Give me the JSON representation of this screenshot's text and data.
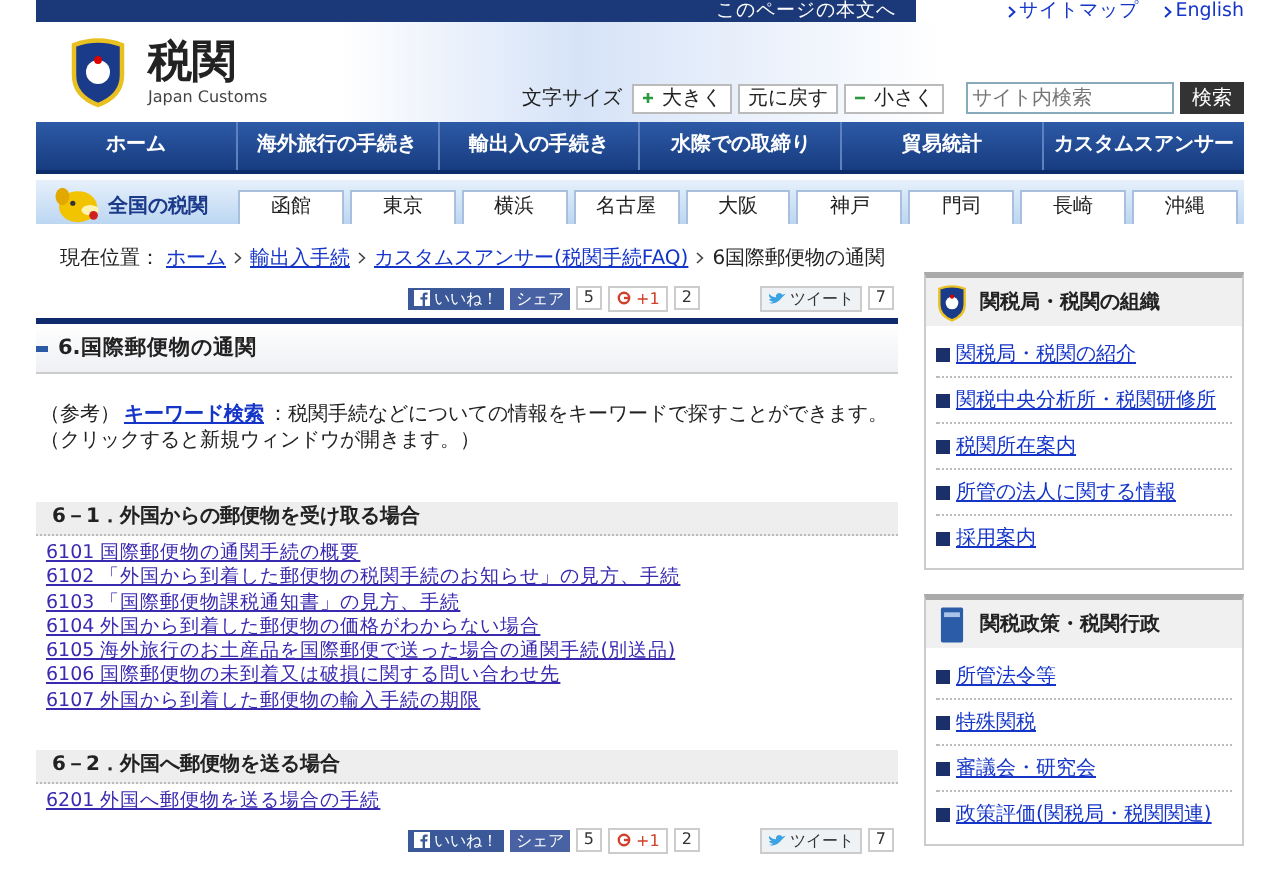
{
  "top_bar": {
    "skip_link": "このページの本文へ",
    "links": [
      "サイトマップ",
      "English"
    ]
  },
  "header": {
    "logo_text": "税関",
    "logo_subtext": "Japan Customs",
    "font_size": {
      "label": "文字サイズ",
      "buttons": [
        {
          "kind": "plus",
          "label": "大きく"
        },
        {
          "kind": "reset",
          "label": "元に戻す"
        },
        {
          "kind": "minus",
          "label": "小さく"
        }
      ]
    },
    "search": {
      "placeholder": "サイト内検索",
      "button": "検索"
    }
  },
  "nav": [
    "ホーム",
    "海外旅行の手続き",
    "輸出入の手続き",
    "水際での取締り",
    "貿易統計",
    "カスタムスアンサー"
  ],
  "regions": {
    "title": "全国の税関",
    "items": [
      "函館",
      "東京",
      "横浜",
      "名古屋",
      "大阪",
      "神戸",
      "門司",
      "長崎",
      "沖縄"
    ]
  },
  "breadcrumb": {
    "label": "現在位置：",
    "links": [
      "ホーム",
      "輸出入手続",
      "カスタムスアンサー(税関手続FAQ)"
    ],
    "current": "6国際郵便物の通関"
  },
  "social": [
    {
      "like": "いいね！",
      "share": "シェア",
      "share_count": "5",
      "plus": "+1",
      "plus_count": "2",
      "tweet": "ツイート",
      "tweet_count": "7"
    },
    {
      "like": "いいね！",
      "share": "シェア",
      "share_count": "5",
      "plus": "+1",
      "plus_count": "2",
      "tweet": "ツイート",
      "tweet_count": "7"
    }
  ],
  "page_title": "6.国際郵便物の通関",
  "reference": {
    "prefix": "（参考）",
    "link": "キーワード検索",
    "text": "：税関手続などについての情報をキーワードで探すことができます。",
    "note": "（クリックすると新規ウィンドウが開きます。）"
  },
  "sections": [
    {
      "title": "6－1．外国からの郵便物を受け取る場合",
      "links": [
        "6101 国際郵便物の通関手続の概要",
        "6102 「外国から到着した郵便物の税関手続のお知らせ」の見方、手続",
        "6103 「国際郵便物課税通知書」の見方、手続",
        "6104 外国から到着した郵便物の価格がわからない場合",
        "6105 海外旅行のお土産品を国際郵便で送った場合の通関手続(別送品)",
        "6106 国際郵便物の未到着又は破損に関する問い合わせ先",
        "6107 外国から到着した郵便物の輸入手続の期限"
      ]
    },
    {
      "title": "6－2．外国へ郵便物を送る場合",
      "links": [
        "6201 外国へ郵便物を送る場合の手続"
      ]
    }
  ],
  "sidebar": [
    {
      "kind": "emblem",
      "title": "関税局・税関の組織",
      "links": [
        "関税局・税関の紹介",
        "関税中央分析所・税関研修所",
        "税関所在案内",
        "所管の法人に関する情報",
        "採用案内"
      ]
    },
    {
      "kind": "book",
      "title": "関税政策・税関行政",
      "links": [
        "所管法令等",
        "特殊関税",
        "審議会・研究会",
        "政策評価(関税局・税関関連)"
      ]
    }
  ]
}
